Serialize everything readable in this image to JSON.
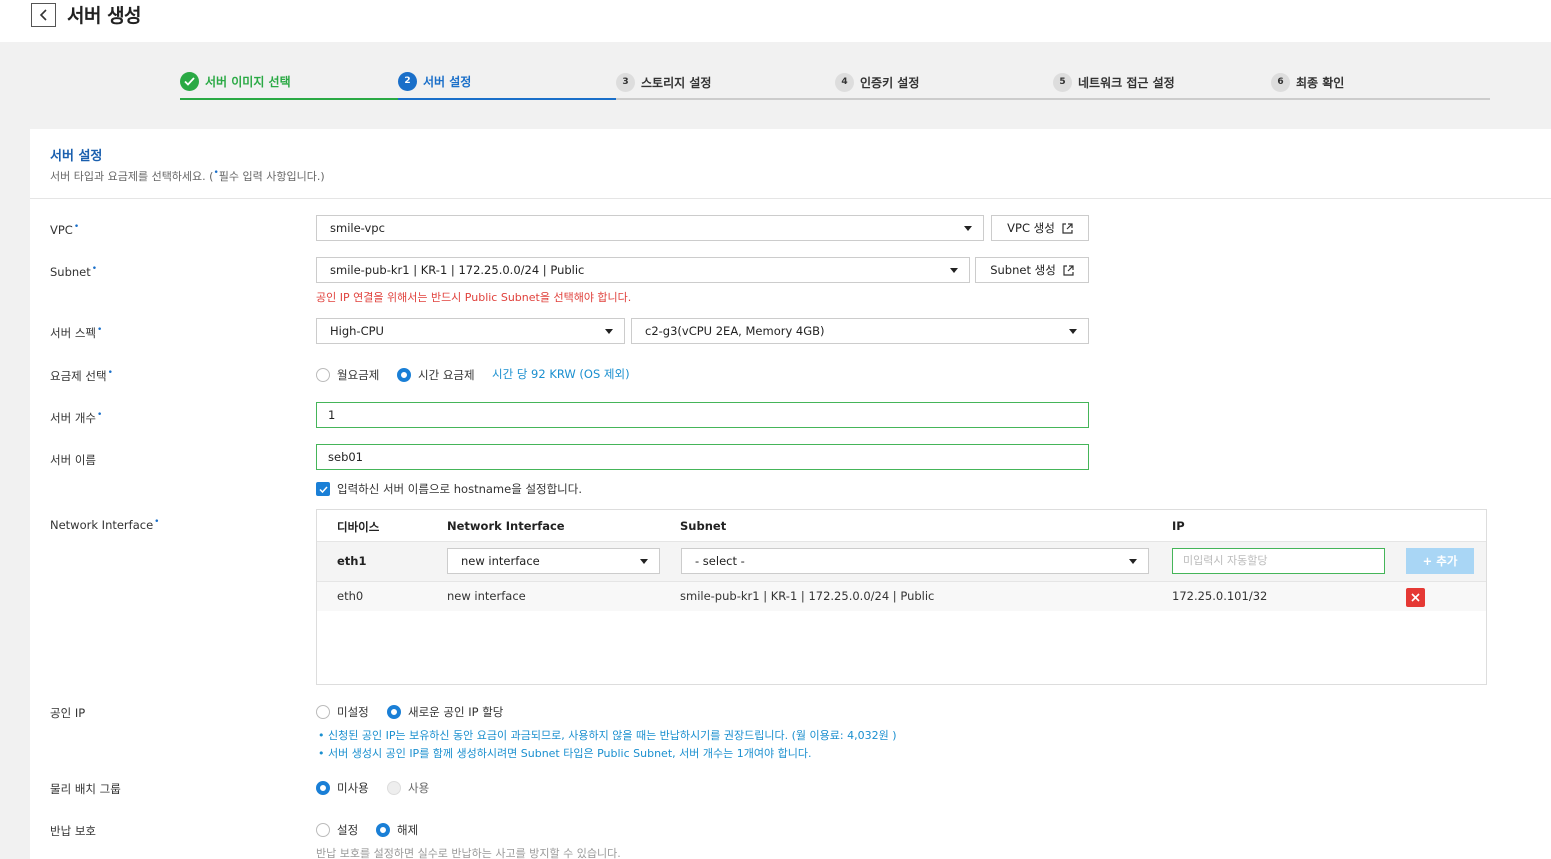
{
  "header": {
    "title": "서버 생성"
  },
  "steps": [
    {
      "num": "1",
      "label": "서버 이미지 선택"
    },
    {
      "num": "2",
      "label": "서버 설정"
    },
    {
      "num": "3",
      "label": "스토리지 설정"
    },
    {
      "num": "4",
      "label": "인증키 설정"
    },
    {
      "num": "5",
      "label": "네트워크 접근 설정"
    },
    {
      "num": "6",
      "label": "최종 확인"
    }
  ],
  "section": {
    "title": "서버 설정",
    "desc_before": "서버 타입과 요금제를 선택하세요. (",
    "desc_dot": "•",
    "desc_after": "필수 입력 사항입니다.)"
  },
  "required_mark": "•",
  "vpc": {
    "label": "VPC",
    "value": "smile-vpc",
    "create_btn": "VPC 생성"
  },
  "subnet": {
    "label": "Subnet",
    "value": "smile-pub-kr1 | KR-1 | 172.25.0.0/24 | Public",
    "create_btn": "Subnet 생성",
    "warning": "공인 IP 연결을 위해서는 반드시 Public Subnet을 선택해야 합니다."
  },
  "spec": {
    "label": "서버 스펙",
    "type": "High-CPU",
    "size": "c2-g3(vCPU 2EA, Memory 4GB)"
  },
  "billing": {
    "label": "요금제 선택",
    "monthly": "월요금제",
    "hourly": "시간 요금제",
    "price_info": "시간 당 92 KRW (OS 제외)"
  },
  "count": {
    "label": "서버 개수",
    "value": "1"
  },
  "name": {
    "label": "서버 이름",
    "value": "seb01",
    "hostname_check": "입력하신 서버 이름으로 hostname을 설정합니다."
  },
  "network_interface": {
    "label": "Network Interface",
    "headers": [
      "디바이스",
      "Network Interface",
      "Subnet",
      "IP"
    ],
    "new_row": {
      "device": "eth1",
      "interface": "new interface",
      "subnet": "- select -",
      "ip_placeholder": "미입력시 자동할당",
      "add_btn": "+ 추가"
    },
    "rows": [
      {
        "device": "eth0",
        "interface": "new interface",
        "subnet": "smile-pub-kr1 | KR-1 | 172.25.0.0/24 | Public",
        "ip": "172.25.0.101/32"
      }
    ]
  },
  "public_ip": {
    "label": "공인 IP",
    "none": "미설정",
    "new": "새로운 공인 IP 할당",
    "notes": [
      "• 신청된 공인 IP는 보유하신 동안 요금이 과금되므로, 사용하지 않을 때는 반납하시기를 권장드립니다. (월 이용료: 4,032원 )",
      "• 서버 생성시 공인 IP를 함께 생성하시려면 Subnet 타입은 Public Subnet, 서버 개수는 1개여야 합니다."
    ]
  },
  "placement": {
    "label": "물리 배치 그룹",
    "off": "미사용",
    "on": "사용"
  },
  "termination": {
    "label": "반납 보호",
    "on": "설정",
    "off": "해제",
    "note": "반납 보호를 설정하면 실수로 반납하는 사고를 방지할 수 있습니다."
  },
  "colors": {
    "accent": "#1a7fd6",
    "success": "#2aa944",
    "error": "#e53935"
  }
}
